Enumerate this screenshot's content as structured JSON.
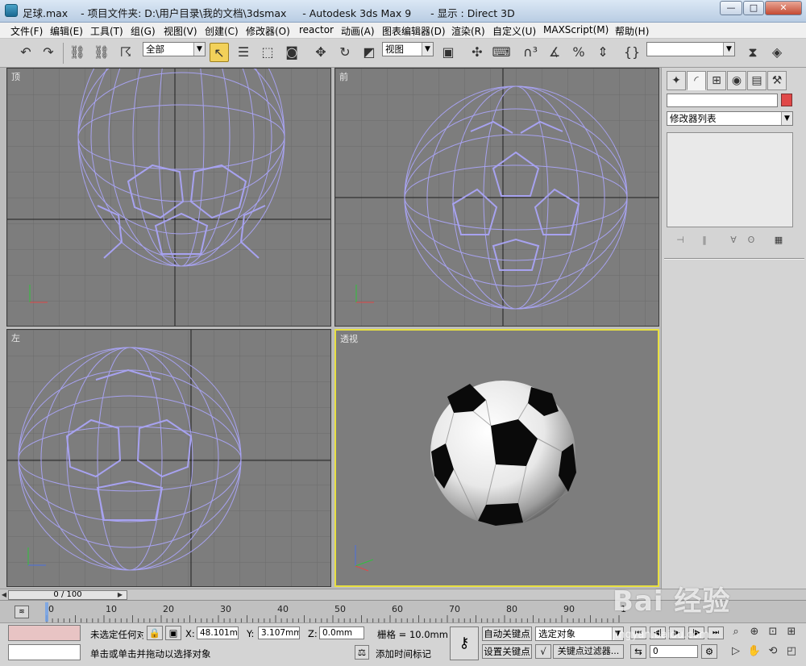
{
  "window": {
    "title": "足球.max    - 项目文件夹: D:\\用户目录\\我的文档\\3dsmax     - Autodesk 3ds Max 9      - 显示 : Direct 3D",
    "controls": {
      "minimize": "—",
      "maximize": "□",
      "close": "✕"
    }
  },
  "menubar": [
    "文件(F)",
    "编辑(E)",
    "工具(T)",
    "组(G)",
    "视图(V)",
    "创建(C)",
    "修改器(O)",
    "reactor",
    "动画(A)",
    "图表编辑器(D)",
    "渲染(R)",
    "自定义(U)",
    "MAXScript(M)",
    "帮助(H)"
  ],
  "toolbar": {
    "selection_filter": "全部",
    "reference_coord": "视图",
    "named_selection": ""
  },
  "viewports": {
    "top": "顶",
    "front": "前",
    "left": "左",
    "perspective": "透视"
  },
  "command_panel": {
    "tabs": [
      "create",
      "modify",
      "hierarchy",
      "motion",
      "display",
      "utilities"
    ],
    "modifier_list": "修改器列表",
    "object_color": "#e04848"
  },
  "time": {
    "slider": "0 / 100",
    "ticks": [
      "0",
      "10",
      "20",
      "30",
      "40",
      "50",
      "60",
      "70",
      "80",
      "90",
      "100"
    ]
  },
  "status": {
    "selection": "未选定任何对",
    "x_label": "X:",
    "x_value": "48.101mm",
    "y_label": "Y:",
    "y_value": "3.107mm",
    "z_label": "Z:",
    "z_value": "0.0mm",
    "grid": "栅格 = 10.0mm",
    "prompt": "单击或单击并拖动以选择对象",
    "add_time_tag": "添加时间标记",
    "auto_key": "自动关键点",
    "set_key": "设置关键点",
    "key_mode": "选定对象",
    "key_filters": "关键点过滤器...",
    "frame": "0"
  },
  "watermark": {
    "main": "Bai 经验",
    "sub": "jingyan.baidu.com"
  }
}
